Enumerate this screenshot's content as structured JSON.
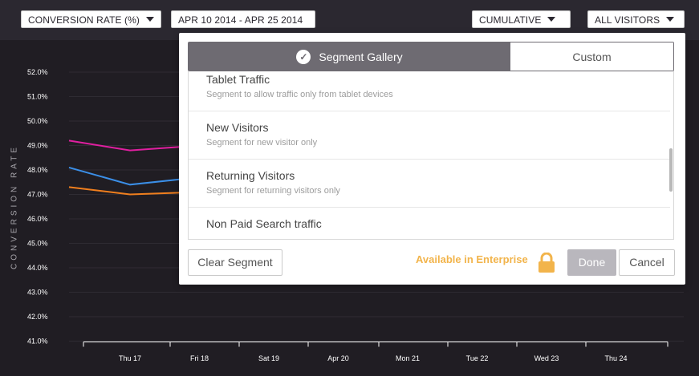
{
  "toolbar": {
    "metric_label": "CONVERSION RATE (%)",
    "date_range_label": "APR 10 2014 - APR 25 2014",
    "mode_label": "CUMULATIVE",
    "segment_label": "ALL VISITORS"
  },
  "chart_data": {
    "type": "line",
    "ylabel": "CONVERSION RATE",
    "y_ticks": [
      "52.0%",
      "51.0%",
      "50.0%",
      "49.0%",
      "48.0%",
      "47.0%",
      "46.0%",
      "45.0%",
      "44.0%",
      "43.0%",
      "42.0%",
      "41.0%"
    ],
    "ylim": [
      41,
      52
    ],
    "x_ticks": [
      "Thu 17",
      "Fri 18",
      "Sat 19",
      "Apr 20",
      "Mon 21",
      "Tue 22",
      "Wed 23",
      "Thu 24"
    ],
    "grid": true,
    "series": [
      {
        "color": "#e01fa0",
        "x": [
          16,
          17,
          18
        ],
        "y": [
          49.2,
          48.8,
          49.0
        ]
      },
      {
        "color": "#3b8fe8",
        "x": [
          16,
          17,
          18
        ],
        "y": [
          48.1,
          47.4,
          47.7
        ]
      },
      {
        "color": "#f07f1e",
        "x": [
          16,
          17,
          18
        ],
        "y": [
          47.3,
          47.0,
          47.1
        ]
      }
    ]
  },
  "modal": {
    "tabs": [
      {
        "label": "Segment Gallery",
        "active": true
      },
      {
        "label": "Custom",
        "active": false
      }
    ],
    "segments": [
      {
        "title": "Tablet Traffic",
        "description": "Segment to allow traffic only from tablet devices"
      },
      {
        "title": "New Visitors",
        "description": "Segment for new visitor only"
      },
      {
        "title": "Returning Visitors",
        "description": "Segment for returning visitors only"
      },
      {
        "title": "Non Paid Search traffic",
        "description": ""
      }
    ],
    "clear_label": "Clear Segment",
    "enterprise_label": "Available in Enterprise",
    "done_label": "Done",
    "cancel_label": "Cancel",
    "lock_icon": "lock-icon",
    "check_icon": "check-circle-icon",
    "accent_color": "#f2b44b"
  }
}
